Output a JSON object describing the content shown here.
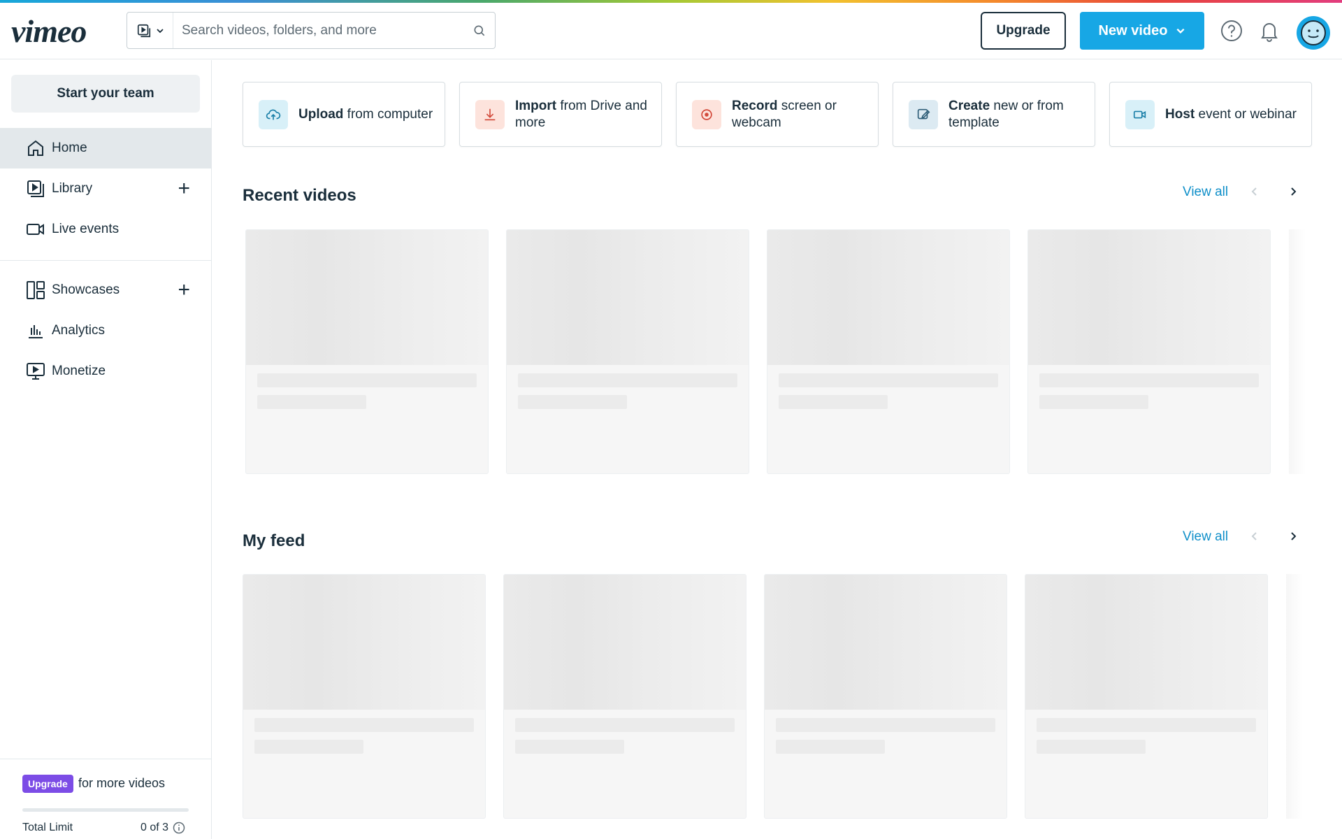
{
  "header": {
    "logo": "vimeo",
    "search_placeholder": "Search videos, folders, and more",
    "upgrade_label": "Upgrade",
    "new_video_label": "New video"
  },
  "sidebar": {
    "team_button": "Start your team",
    "items": [
      {
        "label": "Home",
        "icon": "home-icon"
      },
      {
        "label": "Library",
        "icon": "library-icon"
      },
      {
        "label": "Live events",
        "icon": "live-events-icon"
      },
      {
        "label": "Showcases",
        "icon": "showcases-icon"
      },
      {
        "label": "Analytics",
        "icon": "analytics-icon"
      },
      {
        "label": "Monetize",
        "icon": "monetize-icon"
      }
    ],
    "upgrade_badge": "Upgrade",
    "upgrade_text": "for more videos",
    "limit_label": "Total Limit",
    "limit_count": "0 of 3",
    "limit_progress": 0
  },
  "actions": [
    {
      "bold": "Upload",
      "rest": " from computer",
      "icon": "upload-cloud-icon",
      "color": "#d8f0f8"
    },
    {
      "bold": "Import",
      "rest": " from Drive and more",
      "icon": "import-icon",
      "color": "#fde3dc"
    },
    {
      "bold": "Record",
      "rest": " screen or webcam",
      "icon": "record-icon",
      "color": "#fde3dc"
    },
    {
      "bold": "Create",
      "rest": " new or from template",
      "icon": "create-icon",
      "color": "#dceaf2"
    },
    {
      "bold": "Host",
      "rest": " event or webinar",
      "icon": "host-camera-icon",
      "color": "#d8f0f8"
    }
  ],
  "sections": {
    "recent": {
      "title": "Recent videos",
      "view_all": "View all"
    },
    "feed": {
      "title": "My feed",
      "view_all": "View all"
    }
  },
  "colors": {
    "accent": "#17a7e5",
    "upgrade_purple": "#7c4ce6",
    "link": "#0f8fc9"
  }
}
